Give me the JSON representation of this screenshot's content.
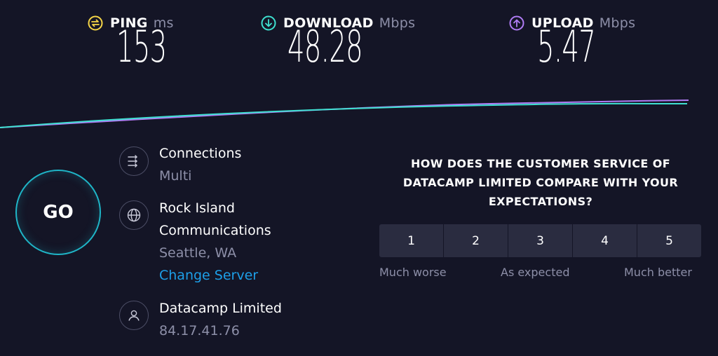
{
  "metrics": {
    "ping": {
      "label": "PING",
      "unit": "ms",
      "value": "153",
      "color": "#f5d547",
      "icon": "ping-icon"
    },
    "download": {
      "label": "DOWNLOAD",
      "unit": "Mbps",
      "value": "48.28",
      "color": "#3ee0d0",
      "icon": "download-arrow-icon"
    },
    "upload": {
      "label": "UPLOAD",
      "unit": "Mbps",
      "value": "5.47",
      "color": "#b07cf5",
      "icon": "upload-arrow-icon"
    }
  },
  "go_button": {
    "label": "GO",
    "accent": "#1fb5c7"
  },
  "connections": {
    "label": "Connections",
    "value": "Multi",
    "icon": "connections-icon"
  },
  "server": {
    "name_line1": "Rock Island",
    "name_line2": "Communications",
    "location": "Seattle, WA",
    "change_link": "Change Server",
    "icon": "globe-icon"
  },
  "provider": {
    "name": "Datacamp Limited",
    "ip": "84.17.41.76",
    "icon": "user-icon"
  },
  "survey": {
    "question_line1": "HOW DOES THE CUSTOMER SERVICE OF",
    "question_line2": "DATACAMP LIMITED COMPARE WITH YOUR",
    "question_line3": "EXPECTATIONS?",
    "options": [
      "1",
      "2",
      "3",
      "4",
      "5"
    ],
    "low_label": "Much worse",
    "mid_label": "As expected",
    "high_label": "Much better"
  },
  "colors": {
    "background": "#141526",
    "link": "#1d9fe8",
    "muted": "#8d8fa8"
  }
}
